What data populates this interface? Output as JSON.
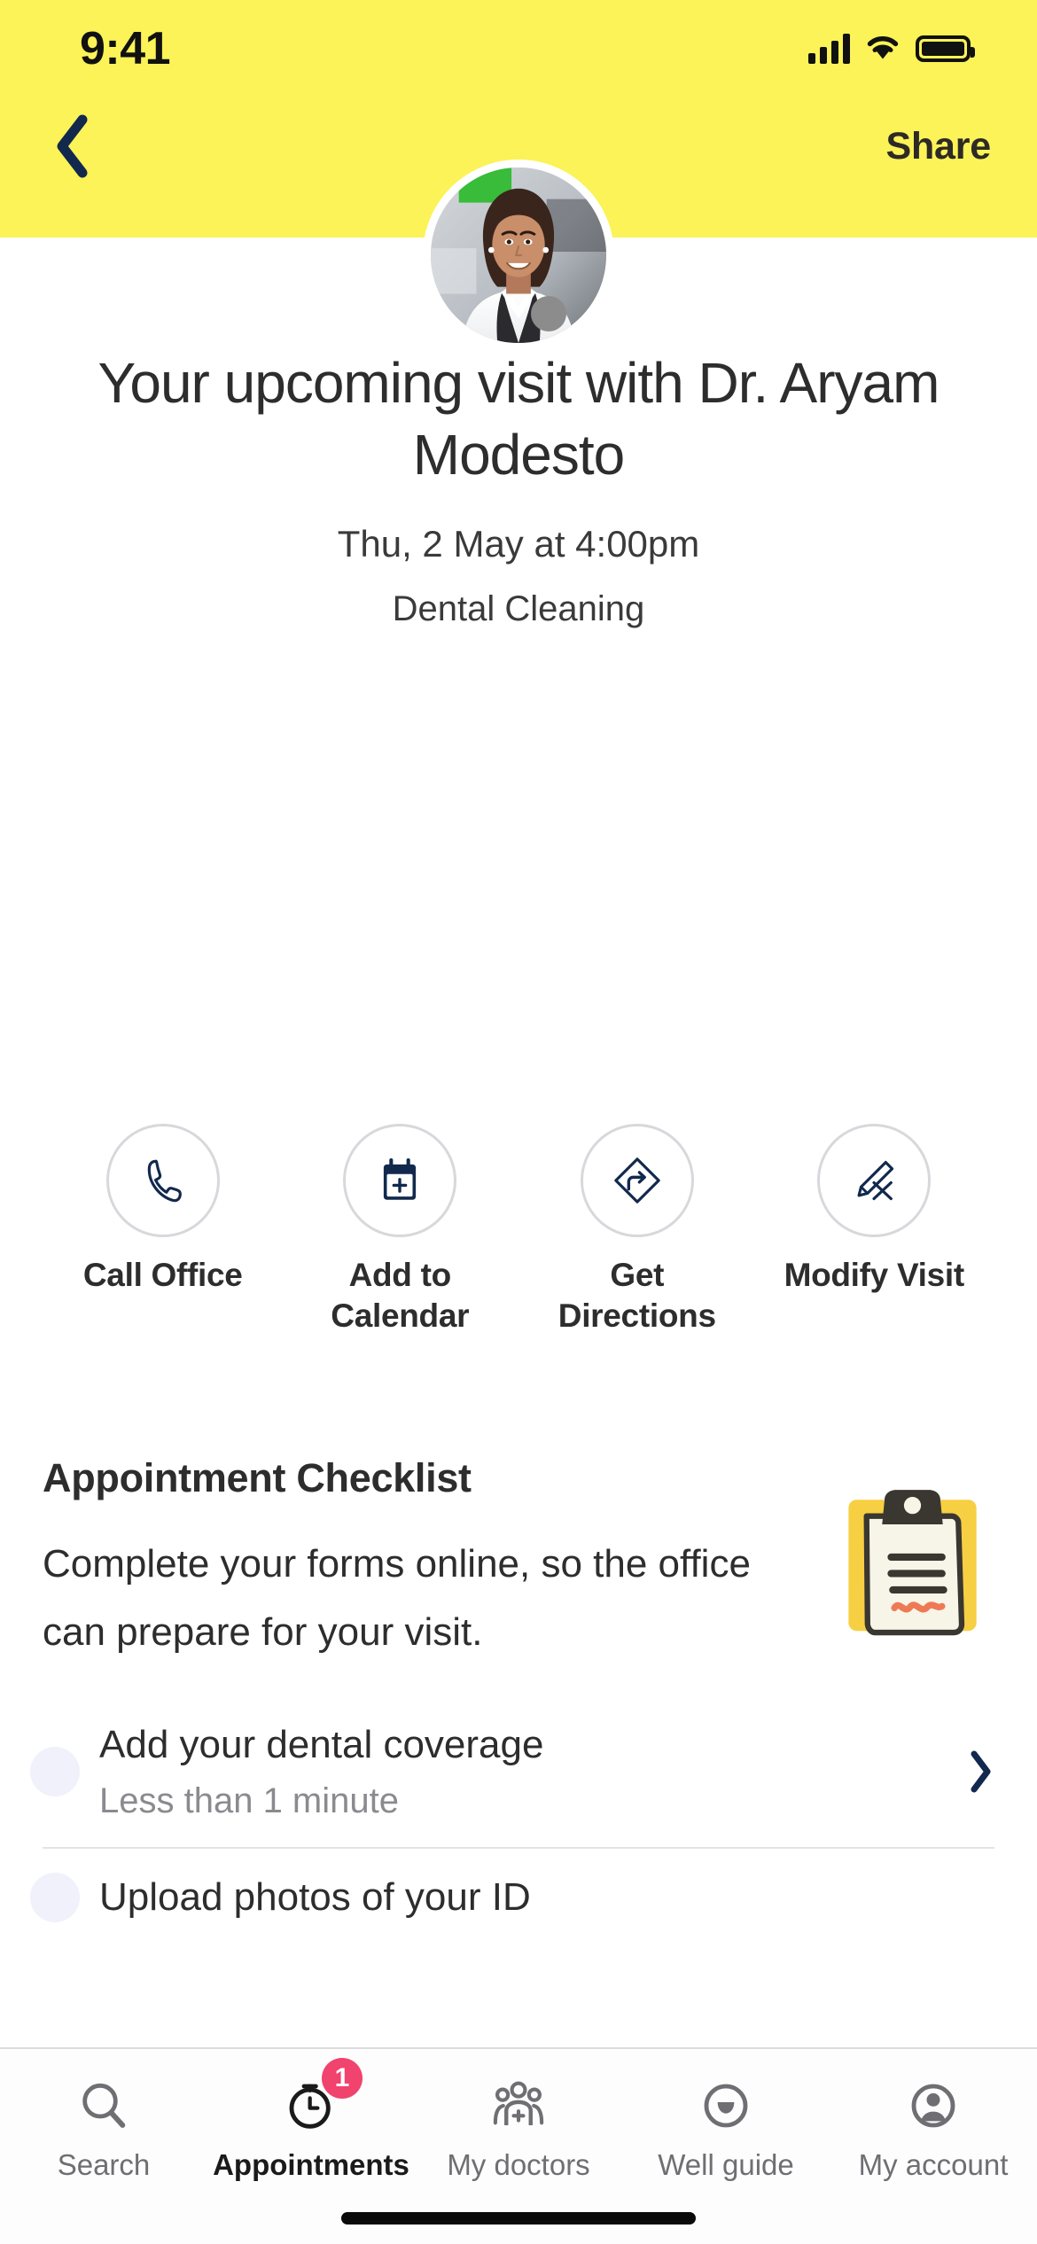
{
  "status_bar": {
    "time": "9:41",
    "signal_icon": "cellular-signal-icon",
    "wifi_icon": "wifi-icon",
    "battery_icon": "battery-full-icon"
  },
  "nav": {
    "back_icon": "chevron-left-icon",
    "share_label": "Share"
  },
  "header": {
    "background_color": "#FBF357",
    "avatar_name": "doctor-avatar",
    "status_dot_color": "#8C8C8C"
  },
  "hero": {
    "title": "Your upcoming visit with Dr. Aryam Modesto",
    "date": "Thu, 2 May at 4:00pm",
    "visit_type": "Dental Cleaning"
  },
  "actions": [
    {
      "label": "Call Office",
      "icon": "phone-icon"
    },
    {
      "label": "Add to Calendar",
      "icon": "calendar-plus-icon"
    },
    {
      "label": "Get Directions",
      "icon": "directions-icon"
    },
    {
      "label": "Modify Visit",
      "icon": "pencil-icon"
    }
  ],
  "checklist": {
    "title": "Appointment Checklist",
    "description": "Complete your forms online, so the office can prepare for your visit.",
    "illustration": "clipboard-illustration",
    "items": [
      {
        "title": "Add your dental coverage",
        "subtitle": "Less than 1 minute",
        "chevron": "chevron-right-icon"
      },
      {
        "title": "Upload photos of your ID",
        "subtitle": "",
        "chevron": "chevron-right-icon"
      }
    ]
  },
  "tabbar": {
    "tabs": [
      {
        "label": "Search",
        "icon": "search-icon",
        "active": false,
        "badge": ""
      },
      {
        "label": "Appointments",
        "icon": "clock-icon",
        "active": true,
        "badge": "1"
      },
      {
        "label": "My doctors",
        "icon": "doctors-group-icon",
        "active": false,
        "badge": ""
      },
      {
        "label": "Well guide",
        "icon": "smiley-icon",
        "active": false,
        "badge": ""
      },
      {
        "label": "My account",
        "icon": "account-circle-icon",
        "active": false,
        "badge": ""
      }
    ],
    "badge_color": "#F0436E"
  }
}
